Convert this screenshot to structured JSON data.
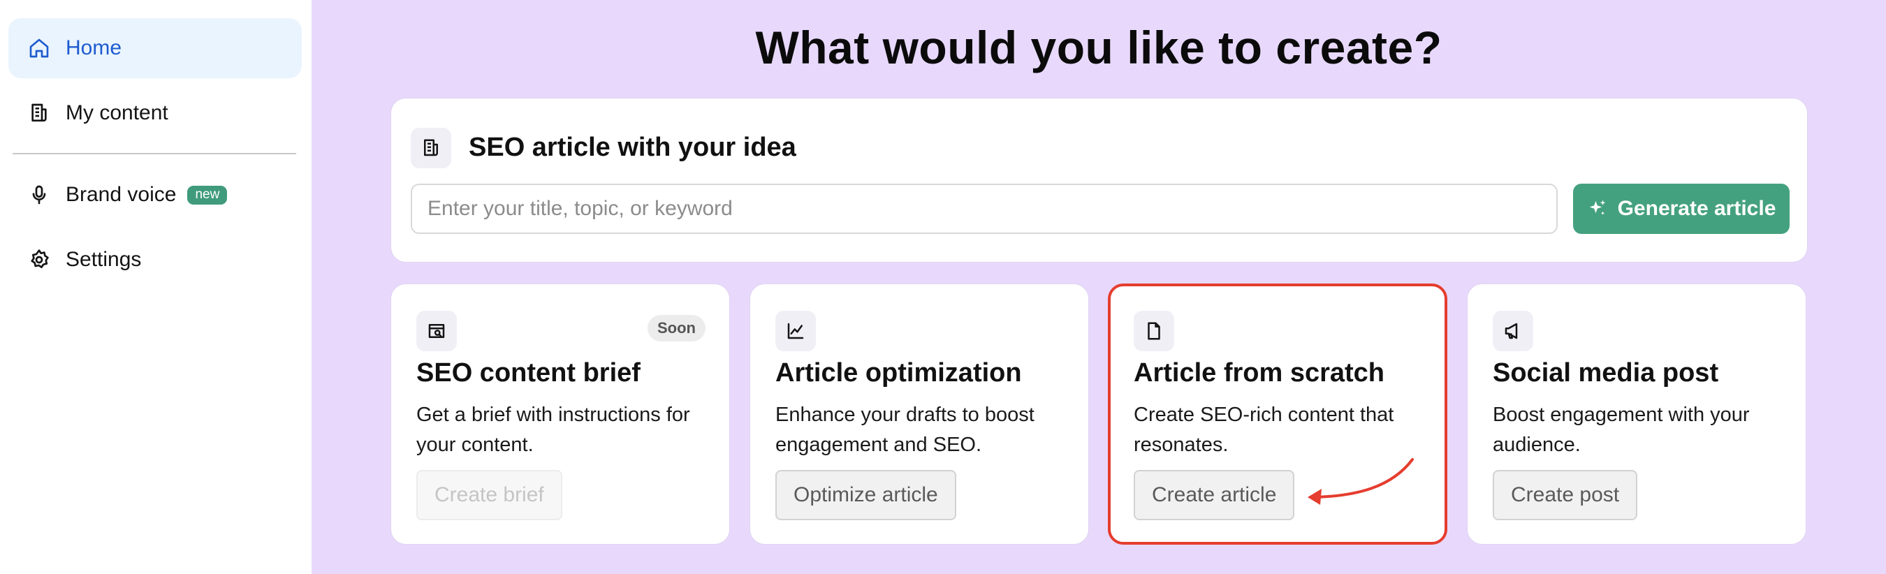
{
  "sidebar": {
    "items": [
      {
        "label": "Home",
        "icon": "home-icon",
        "active": true
      },
      {
        "label": "My content",
        "icon": "document-icon"
      },
      {
        "label": "Brand voice",
        "icon": "microphone-icon",
        "badge": "new"
      },
      {
        "label": "Settings",
        "icon": "gear-icon"
      }
    ]
  },
  "main": {
    "title": "What would you like to create?",
    "idea": {
      "title": "SEO article with your idea",
      "input_placeholder": "Enter your title, topic, or keyword",
      "input_value": "",
      "button_label": "Generate article"
    },
    "cards": [
      {
        "title": "SEO content brief",
        "desc": "Get a brief with instructions for your content.",
        "button": "Create brief",
        "badge": "Soon",
        "icon": "search-document-icon",
        "disabled": true
      },
      {
        "title": "Article optimization",
        "desc": "Enhance your drafts to boost engagement and SEO.",
        "button": "Optimize article",
        "icon": "chart-line-icon"
      },
      {
        "title": "Article from scratch",
        "desc": "Create SEO-rich content that resonates.",
        "button": "Create article",
        "icon": "file-icon",
        "highlighted": true
      },
      {
        "title": "Social media post",
        "desc": "Boost engagement with your audience.",
        "button": "Create post",
        "icon": "megaphone-icon"
      }
    ]
  },
  "colors": {
    "accent_green": "#44a17f",
    "active_nav_bg": "#e9f4fe",
    "main_bg": "#e8d9fc",
    "highlight_red": "#e53d2f"
  }
}
